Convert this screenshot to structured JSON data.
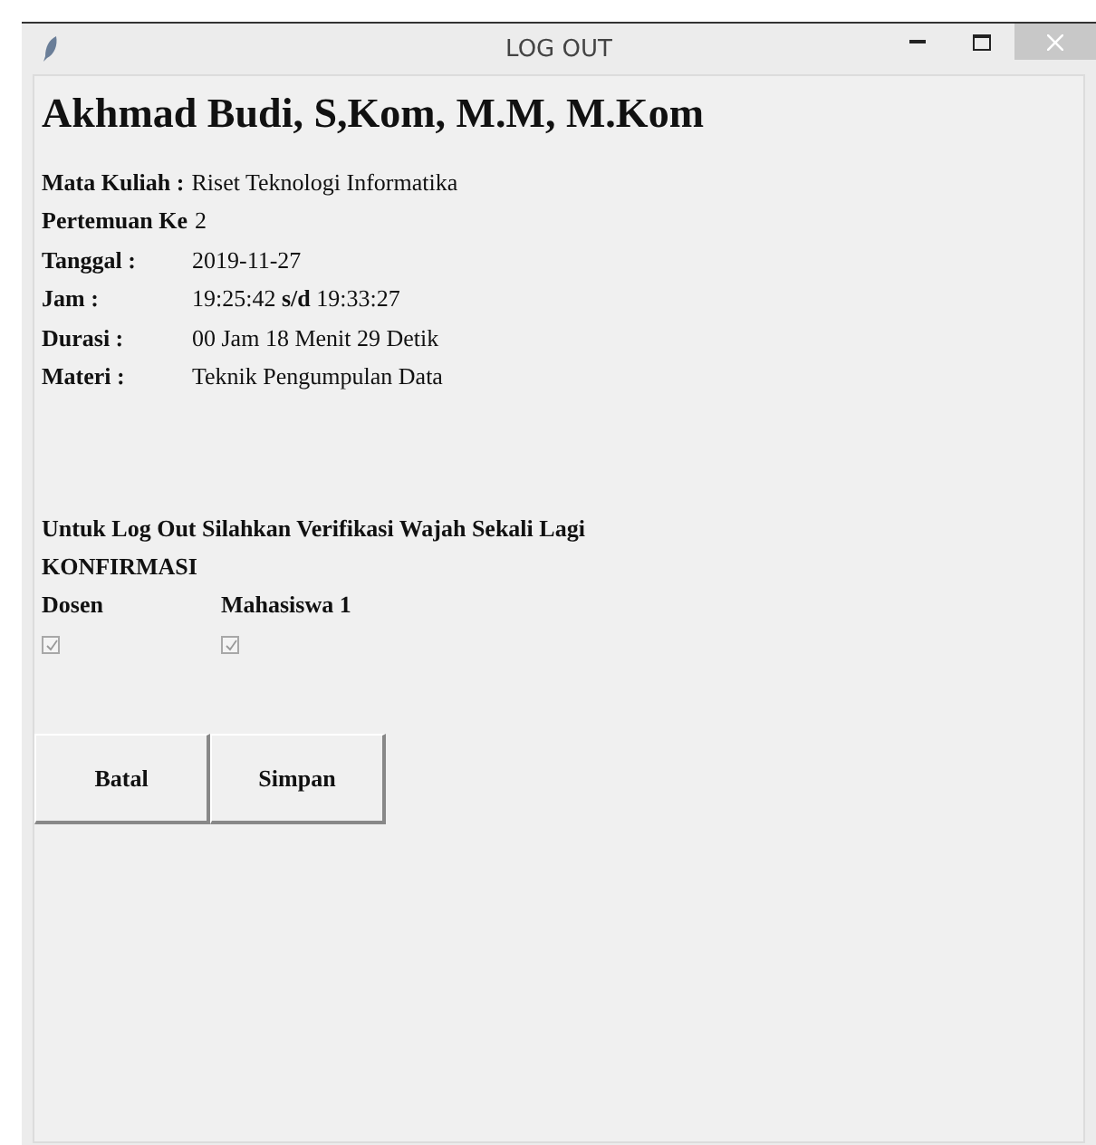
{
  "window": {
    "title": "LOG OUT"
  },
  "name": "Akhmad Budi, S,Kom, M.M, M.Kom",
  "info": [
    {
      "kind": "inline",
      "label": "Mata Kuliah :",
      "value": "Riset Teknologi Informatika"
    },
    {
      "kind": "inline",
      "label": "Pertemuan Ke",
      "value": "2"
    },
    {
      "kind": "column",
      "label": "Tanggal :",
      "value": "2019-11-27"
    },
    {
      "kind": "column",
      "label": "Jam :",
      "value": "19:25:42 **s/d** 19:33:27"
    },
    {
      "kind": "column",
      "label": "Durasi :",
      "value": "00 Jam 18 Menit 29 Detik"
    },
    {
      "kind": "column",
      "label": "Materi :",
      "value": "Teknik Pengumpulan Data"
    }
  ],
  "instruction": "Untuk Log Out Silahkan Verifikasi Wajah Sekali Lagi",
  "confirmation": {
    "title": "KONFIRMASI",
    "items": [
      {
        "label": "Dosen",
        "checked": true
      },
      {
        "label": "Mahasiswa 1",
        "checked": true
      }
    ]
  },
  "buttons": [
    "Batal",
    "Simpan"
  ]
}
